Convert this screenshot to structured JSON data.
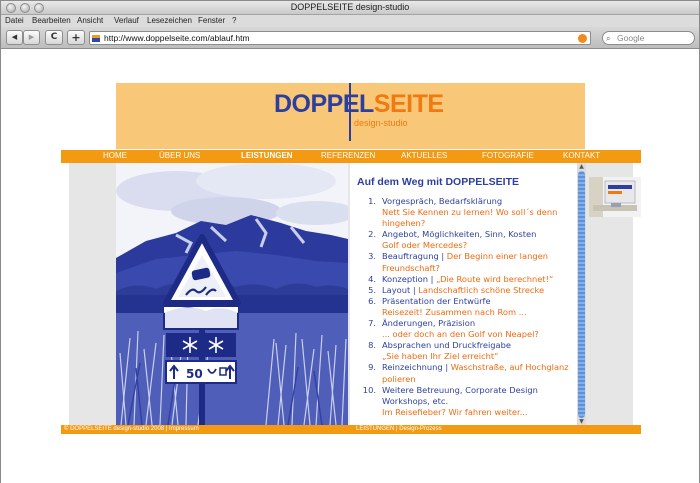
{
  "window": {
    "title": "DOPPELSEITE design-studio"
  },
  "menu": [
    "Datei",
    "Bearbeiten",
    "Ansicht",
    "Verlauf",
    "Lesezeichen",
    "Fenster",
    "?"
  ],
  "toolbar": {
    "back": "◀",
    "forward": "▶",
    "reload": "C",
    "add": "+",
    "url": "http://www.doppelseite.com/ablauf.htm",
    "search_placeholder": "Google"
  },
  "site": {
    "logo_part1": "DOPPEL",
    "logo_part2": "SEITE",
    "logo_sub": "design-studio",
    "nav": [
      "HOME",
      "ÜBER UNS",
      "LEISTUNGEN",
      "REFERENZEN",
      "AKTUELLES",
      "FOTOGRAFIE",
      "KONTAKT"
    ],
    "active_nav": "LEISTUNGEN",
    "colors": {
      "orange": "#f39a12",
      "blue": "#2d3f9e",
      "banner": "#f8c878",
      "accent_text": "#f06a10"
    }
  },
  "content": {
    "title": "Auf dem Weg mit DOPPELSEITE",
    "steps": [
      {
        "num": "1.",
        "title": "Vorgespräch, Bedarfsklärung",
        "sub": "Nett Sie Kennen zu lernen! Wo soll´s denn hingehen?"
      },
      {
        "num": "2.",
        "title": "Angebot, Möglichkeiten, Sinn, Kosten",
        "sub": "Golf oder Mercedes?"
      },
      {
        "num": "3.",
        "title": "Beauftragung",
        "inline": "Der Beginn einer langen Freundschaft?"
      },
      {
        "num": "4.",
        "title": "Konzeption",
        "inline": "„Die Route wird berechnet!“"
      },
      {
        "num": "5.",
        "title": "Layout",
        "inline": "Landschaftlich schöne Strecke"
      },
      {
        "num": "6.",
        "title": "Präsentation der Entwürfe",
        "sub": "Reisezeit! Zusammen nach Rom ..."
      },
      {
        "num": "7.",
        "title": "Änderungen, Präzision",
        "sub": "... oder doch an den Golf von Neapel?"
      },
      {
        "num": "8.",
        "title": "Absprachen und Druckfreigabe",
        "sub": "„Sie haben Ihr Ziel erreicht“"
      },
      {
        "num": "9.",
        "title": "Reinzeichnung",
        "inline": "Waschstraße, auf Hochglanz polieren"
      },
      {
        "num": "10.",
        "title": "Weitere Betreuung, Corporate Design Workshops, etc.",
        "sub": "Im Reisefieber? Wir fahren weiter..."
      }
    ],
    "separator": "|"
  },
  "sign": {
    "speed": "50"
  },
  "footer": {
    "left": "© DOPPELSEITE design-studio 2008 | Impressum",
    "right": "LEISTUNGEN | Design-Prozess"
  }
}
